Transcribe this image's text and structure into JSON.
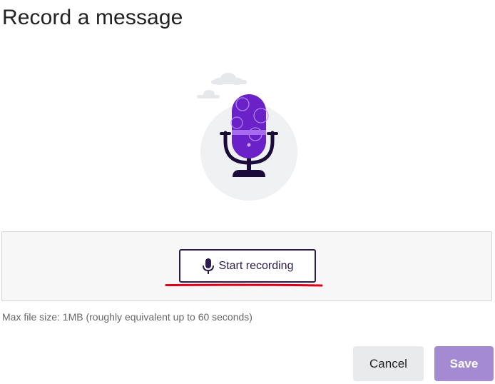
{
  "dialog": {
    "title": "Record a message"
  },
  "illustration": {
    "icon": "microphone-illustration",
    "colors": {
      "mic_body": "#6a21c8",
      "mic_band": "#a56cf0",
      "stand": "#1b0b3a",
      "backdrop": "#f0f1f3",
      "clouds": "#e6e7ea"
    }
  },
  "recorder": {
    "start_label": "Start recording",
    "start_icon": "microphone-icon",
    "hint": "Max file size: 1MB (roughly equivalent up to 60 seconds)",
    "highlight_color": "#d9001b"
  },
  "footer": {
    "cancel_label": "Cancel",
    "save_label": "Save",
    "save_color": "#a48ad0"
  }
}
